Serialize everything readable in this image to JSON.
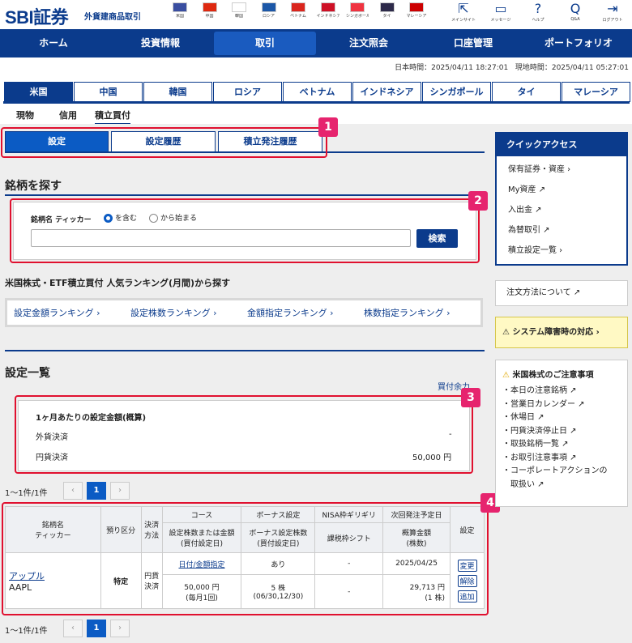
{
  "header": {
    "logo": "SBI証券",
    "logo_sub": "外貨建商品取引",
    "flags": [
      {
        "label": "米国",
        "color": "#3a4ea0"
      },
      {
        "label": "中国",
        "color": "#de2910"
      },
      {
        "label": "韓国",
        "color": "#ffffff"
      },
      {
        "label": "ロシア",
        "color": "#1c57a7"
      },
      {
        "label": "ベトナム",
        "color": "#da251d"
      },
      {
        "label": "インドネシア",
        "color": "#ce1126"
      },
      {
        "label": "シンガポール",
        "color": "#ef3340"
      },
      {
        "label": "タイ",
        "color": "#2d2a4a"
      },
      {
        "label": "マレーシア",
        "color": "#cc0001"
      }
    ],
    "icons": [
      {
        "name": "mainsite-icon",
        "glyph": "⇱",
        "label": "メインサイト"
      },
      {
        "name": "message-icon",
        "glyph": "▭",
        "label": "メッセージ"
      },
      {
        "name": "help-icon",
        "glyph": "?",
        "label": "ヘルプ"
      },
      {
        "name": "qa-icon",
        "glyph": "Q",
        "label": "Q&A"
      },
      {
        "name": "logout-icon",
        "glyph": "⇥",
        "label": "ログアウト"
      }
    ]
  },
  "nav": [
    "ホーム",
    "投資情報",
    "取引",
    "注文照会",
    "口座管理",
    "ポートフォリオ"
  ],
  "time": {
    "jp": "日本時間：2025/04/11 18:27:01",
    "local": "現地時間：2025/04/11 05:27:01"
  },
  "countries": [
    "米国",
    "中国",
    "韓国",
    "ロシア",
    "ベトナム",
    "インドネシア",
    "シンガポール",
    "タイ",
    "マレーシア"
  ],
  "subtabs": [
    "現物",
    "信用",
    "積立買付"
  ],
  "settings_tabs": [
    "設定",
    "設定履歴",
    "積立発注履歴"
  ],
  "badges": [
    "1",
    "2",
    "3",
    "4"
  ],
  "search": {
    "title": "銘柄を探す",
    "label": "銘柄名 ティッカー",
    "opt1": "を含む",
    "opt2": "から始まる",
    "placeholder": "",
    "button": "検索"
  },
  "ranking": {
    "title": "米国株式・ETF積立買付 人気ランキング(月間)から探す",
    "items": [
      "設定金額ランキング ›",
      "設定株数ランキング ›",
      "金額指定ランキング ›",
      "株数指定ランキング ›"
    ]
  },
  "list": {
    "title": "設定一覧",
    "buying_power": "買付余力",
    "summary_title": "1ヶ月あたりの設定金額(概算)",
    "foreign": "外貨決済",
    "foreign_value": "-",
    "yen": "円貨決済",
    "yen_value": "50,000 円",
    "count": "1〜1件/1件",
    "page": "1",
    "prev": "‹",
    "next": "›"
  },
  "table": {
    "h_name": "銘柄名\nティッカー",
    "h_account": "預り区分",
    "h_settle": "決済\n方法",
    "h_course": "コース",
    "h_course_sub": "設定株数または金額\n(買付設定日)",
    "h_bonus": "ボーナス設定",
    "h_bonus_sub": "ボーナス設定株数\n(買付設定日)",
    "h_nisa": "NISA枠ギリギリ",
    "h_nisa_sub": "課税枠シフト",
    "h_next": "次回発注予定日",
    "h_next_sub": "概算金額\n(株数)",
    "h_setting": "設定",
    "row": {
      "name": "アップル",
      "ticker": "AAPL",
      "account": "特定",
      "settle": "円貨\n決済",
      "course_link": "日付/金額指定",
      "course_value": "50,000 円\n(毎月1回)",
      "bonus": "あり",
      "bonus_value": "5 株\n(06/30,12/30)",
      "nisa": "-",
      "nisa_sub": "-",
      "next_date": "2025/04/25",
      "next_amount": "29,713 円\n(1 株)",
      "btn_change": "変更",
      "btn_cancel": "解除",
      "btn_add": "追加"
    }
  },
  "quick": {
    "title": "クイックアクセス",
    "items": [
      "保有証券・資産 ›",
      "My資産 ↗",
      "入出金 ↗",
      "為替取引 ↗",
      "積立設定一覧 ›"
    ]
  },
  "order_method": "注文方法について ↗",
  "outage": "⚠ システム障害時の対応 ›",
  "notice": {
    "title": "米国株式のご注意事項",
    "items": [
      "・本日の注意銘柄 ↗",
      "・営業日カレンダー ↗",
      "・休場日 ↗",
      "・円貨決済停止日 ↗",
      "・取扱銘柄一覧 ↗",
      "・お取引注意事項 ↗",
      "・コーポレートアクションの",
      "　取扱い ↗"
    ]
  }
}
